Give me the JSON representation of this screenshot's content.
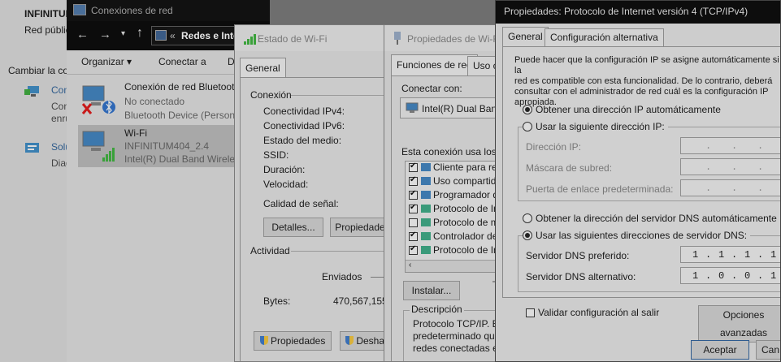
{
  "background_window": {
    "title_partial": "INFINITUI",
    "network_partial": "Red públic",
    "cambiar_partial": "Cambiar la co",
    "item1_label_partial": "Con",
    "item1_sub1_partial": "Con",
    "item1_sub2_partial": "enru",
    "item2_label_partial": "Solu",
    "item2_sub_partial": "Diag"
  },
  "net_connections": {
    "title": "Conexiones de red",
    "address": "Redes e Inte",
    "address_chevron": "«",
    "toolbar": {
      "organize": "Organizar",
      "organize_caret": "▾",
      "connect_to": "Conectar a",
      "extra_partial": "D"
    },
    "connections": [
      {
        "name": "Conexión de red Bluetoot",
        "status": "No conectado",
        "device": "Bluetooth Device (Persona"
      },
      {
        "name": "Wi-Fi",
        "status": "INFINITUM404_2.4",
        "device": "Intel(R) Dual Band Wireles"
      }
    ]
  },
  "wifi_status": {
    "title": "Estado de Wi-Fi",
    "tab_general": "General",
    "section_connection": "Conexión",
    "rows": [
      "Conectividad IPv4:",
      "Conectividad IPv6:",
      "Estado del medio:",
      "SSID:",
      "Duración:",
      "Velocidad:"
    ],
    "signal_quality": "Calidad de señal:",
    "details_button": "Detalles...",
    "properties_button_partial": "Propiedades",
    "section_activity": "Actividad",
    "sent_label": "Enviados",
    "bytes_label": "Bytes:",
    "bytes_sent": "470,567,155",
    "properties_button": "Propiedades",
    "disable_button_partial": "Deshab"
  },
  "wifi_properties": {
    "title": "Propiedades de Wi-Fi",
    "tab_functions": "Funciones de red",
    "tab_shared_partial": "Uso c",
    "connect_with": "Conectar con:",
    "adapter_partial": "Intel(R) Dual Band",
    "uses_items_partial": "Esta conexión usa los sig",
    "items": [
      {
        "label": "Cliente para red",
        "checked": true
      },
      {
        "label": "Uso compartido",
        "checked": true
      },
      {
        "label": "Programador de",
        "checked": true
      },
      {
        "label": "Protocolo de Int",
        "checked": true
      },
      {
        "label": "Protocolo de mu",
        "checked": false
      },
      {
        "label": "Controlador de p",
        "checked": true
      },
      {
        "label": "Protocolo de Int",
        "checked": true
      }
    ],
    "install_button": "Instalar...",
    "description_title": "Descripción",
    "description_lines": [
      "Protocolo TCP/IP. El p",
      "predeterminado que p",
      "redes conectadas entr"
    ]
  },
  "ipv4_dialog": {
    "title": "Propiedades: Protocolo de Internet versión 4 (TCP/IPv4)",
    "tab_general": "General",
    "tab_alternate": "Configuración alternativa",
    "intro_lines": [
      "Puede hacer que la configuración IP se asigne automáticamente si la",
      "red es compatible con esta funcionalidad. De lo contrario, deberá",
      "consultar con el administrador de red cuál es la configuración IP",
      "apropiada."
    ],
    "radio_ip_auto": "Obtener una dirección IP automáticamente",
    "radio_ip_manual": "Usar la siguiente dirección IP:",
    "ip_address_label": "Dirección IP:",
    "subnet_label": "Máscara de subred:",
    "gateway_label": "Puerta de enlace predeterminada:",
    "radio_dns_auto": "Obtener la dirección del servidor DNS automáticamente",
    "radio_dns_manual": "Usar las siguientes direcciones de servidor DNS:",
    "preferred_dns_label": "Servidor DNS preferido:",
    "preferred_dns": [
      "1",
      "1",
      "1",
      "1"
    ],
    "alternate_dns_label": "Servidor DNS alternativo:",
    "alternate_dns": [
      "1",
      "0",
      "0",
      "1"
    ],
    "validate_on_exit": "Validar configuración al salir",
    "advanced_button": "Opciones avanzadas",
    "accept_button": "Aceptar",
    "cancel_button_partial": "Can"
  }
}
